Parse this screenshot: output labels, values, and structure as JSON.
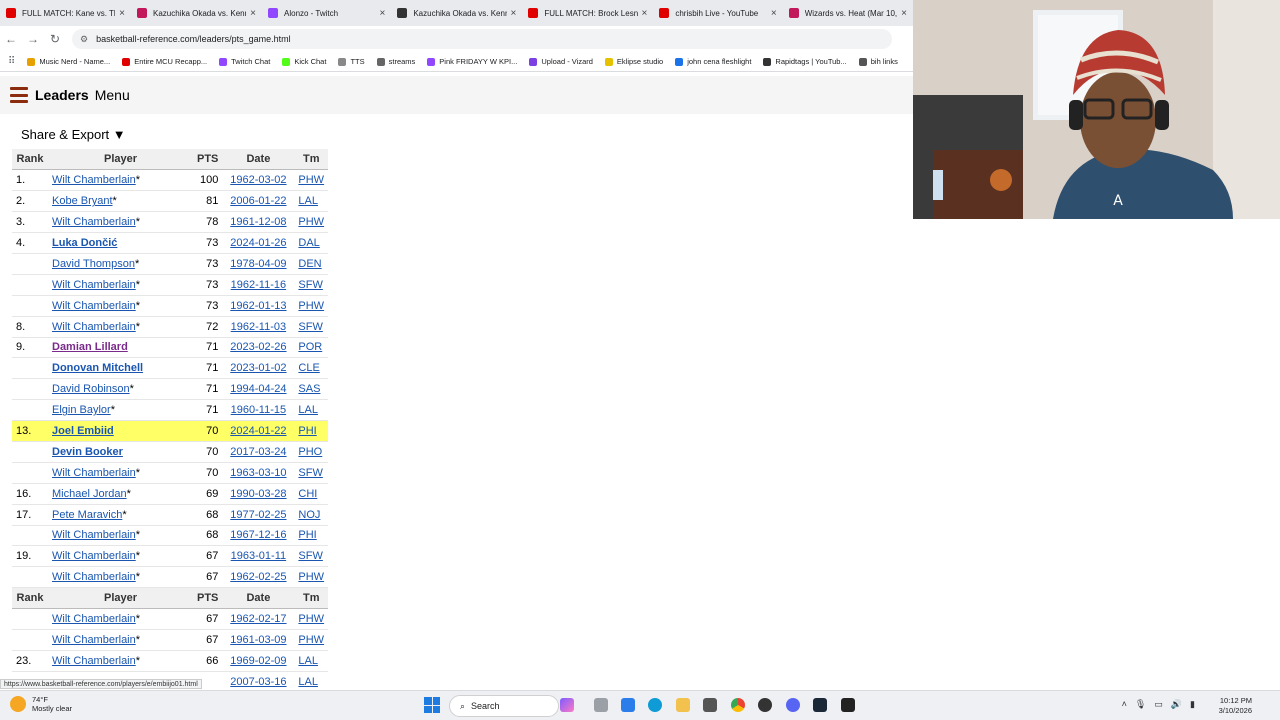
{
  "browser": {
    "tabs": [
      {
        "label": "FULL MATCH: Kane vs. The",
        "color": "#e00000"
      },
      {
        "label": "Kazuchika Okada vs. Kenn",
        "color": "#c2185b"
      },
      {
        "label": "Alonzo - Twitch",
        "color": "#9146ff"
      },
      {
        "label": "Kazuchika Okada vs. Kenn",
        "color": "#333333"
      },
      {
        "label": "FULL MATCH: Brock Lesna",
        "color": "#e00000"
      },
      {
        "label": "chrisbih Live - YouTube",
        "color": "#e00000"
      },
      {
        "label": "Wizards vs. Heat (Mar 10,",
        "color": "#c2185b"
      }
    ],
    "url": "basketball-reference.com/leaders/pts_game.html",
    "bookmarks": [
      {
        "label": "Music Nerd - Name...",
        "color": "#e6a100"
      },
      {
        "label": "Entire MCU Recapp...",
        "color": "#e00000"
      },
      {
        "label": "Twitch Chat",
        "color": "#9146ff"
      },
      {
        "label": "Kick Chat",
        "color": "#53fc18"
      },
      {
        "label": "TTS",
        "color": "#888888"
      },
      {
        "label": "streams",
        "color": "#666666"
      },
      {
        "label": "Pink FRIDAYY W KPI...",
        "color": "#9146ff"
      },
      {
        "label": "Upload - Vizard",
        "color": "#7b3fe4"
      },
      {
        "label": "Eklipse studio",
        "color": "#e6c100"
      },
      {
        "label": "john cena fleshlight",
        "color": "#1a73e8"
      },
      {
        "label": "Rapidtags | YouTub...",
        "color": "#333333"
      },
      {
        "label": "bih links",
        "color": "#555555"
      }
    ]
  },
  "site": {
    "title": "Leaders",
    "menu": "Menu",
    "share_export": "Share & Export ▼"
  },
  "table": {
    "headers": {
      "rank": "Rank",
      "player": "Player",
      "pts": "PTS",
      "date": "Date",
      "tm": "Tm"
    },
    "rows": [
      {
        "rank": "1.",
        "player": "Wilt Chamberlain",
        "star": "*",
        "pts": "100",
        "date": "1962-03-02",
        "tm": "PHW",
        "style": "normal"
      },
      {
        "rank": "2.",
        "player": "Kobe Bryant",
        "star": "*",
        "pts": "81",
        "date": "2006-01-22",
        "tm": "LAL",
        "style": "normal"
      },
      {
        "rank": "3.",
        "player": "Wilt Chamberlain",
        "star": "*",
        "pts": "78",
        "date": "1961-12-08",
        "tm": "PHW",
        "style": "normal"
      },
      {
        "rank": "4.",
        "player": "Luka Dončić",
        "star": "",
        "pts": "73",
        "date": "2024-01-26",
        "tm": "DAL",
        "style": "active"
      },
      {
        "rank": "",
        "player": "David Thompson",
        "star": "*",
        "pts": "73",
        "date": "1978-04-09",
        "tm": "DEN",
        "style": "normal"
      },
      {
        "rank": "",
        "player": "Wilt Chamberlain",
        "star": "*",
        "pts": "73",
        "date": "1962-11-16",
        "tm": "SFW",
        "style": "normal"
      },
      {
        "rank": "",
        "player": "Wilt Chamberlain",
        "star": "*",
        "pts": "73",
        "date": "1962-01-13",
        "tm": "PHW",
        "style": "normal"
      },
      {
        "rank": "8.",
        "player": "Wilt Chamberlain",
        "star": "*",
        "pts": "72",
        "date": "1962-11-03",
        "tm": "SFW",
        "style": "normal"
      },
      {
        "rank": "9.",
        "player": "Damian Lillard",
        "star": "",
        "pts": "71",
        "date": "2023-02-26",
        "tm": "POR",
        "style": "visited"
      },
      {
        "rank": "",
        "player": "Donovan Mitchell",
        "star": "",
        "pts": "71",
        "date": "2023-01-02",
        "tm": "CLE",
        "style": "active"
      },
      {
        "rank": "",
        "player": "David Robinson",
        "star": "*",
        "pts": "71",
        "date": "1994-04-24",
        "tm": "SAS",
        "style": "normal"
      },
      {
        "rank": "",
        "player": "Elgin Baylor",
        "star": "*",
        "pts": "71",
        "date": "1960-11-15",
        "tm": "LAL",
        "style": "normal"
      },
      {
        "rank": "13.",
        "player": "Joel Embiid",
        "star": "",
        "pts": "70",
        "date": "2024-01-22",
        "tm": "PHI",
        "style": "active",
        "highlight": true
      },
      {
        "rank": "",
        "player": "Devin Booker",
        "star": "",
        "pts": "70",
        "date": "2017-03-24",
        "tm": "PHO",
        "style": "active"
      },
      {
        "rank": "",
        "player": "Wilt Chamberlain",
        "star": "*",
        "pts": "70",
        "date": "1963-03-10",
        "tm": "SFW",
        "style": "normal"
      },
      {
        "rank": "16.",
        "player": "Michael Jordan",
        "star": "*",
        "pts": "69",
        "date": "1990-03-28",
        "tm": "CHI",
        "style": "normal"
      },
      {
        "rank": "17.",
        "player": "Pete Maravich",
        "star": "*",
        "pts": "68",
        "date": "1977-02-25",
        "tm": "NOJ",
        "style": "normal"
      },
      {
        "rank": "",
        "player": "Wilt Chamberlain",
        "star": "*",
        "pts": "68",
        "date": "1967-12-16",
        "tm": "PHI",
        "style": "normal"
      },
      {
        "rank": "19.",
        "player": "Wilt Chamberlain",
        "star": "*",
        "pts": "67",
        "date": "1963-01-11",
        "tm": "SFW",
        "style": "normal"
      },
      {
        "rank": "",
        "player": "Wilt Chamberlain",
        "star": "*",
        "pts": "67",
        "date": "1962-02-25",
        "tm": "PHW",
        "style": "normal"
      }
    ],
    "rows2": [
      {
        "rank": "",
        "player": "Wilt Chamberlain",
        "star": "*",
        "pts": "67",
        "date": "1962-02-17",
        "tm": "PHW",
        "style": "normal"
      },
      {
        "rank": "",
        "player": "Wilt Chamberlain",
        "star": "*",
        "pts": "67",
        "date": "1961-03-09",
        "tm": "PHW",
        "style": "normal"
      },
      {
        "rank": "23.",
        "player": "Wilt Chamberlain",
        "star": "*",
        "pts": "66",
        "date": "1969-02-09",
        "tm": "LAL",
        "style": "normal"
      },
      {
        "rank": "",
        "player": "",
        "star": "",
        "pts": "",
        "date": "2007-03-16",
        "tm": "LAL",
        "style": "normal"
      }
    ]
  },
  "status_url": "https://www.basketball-reference.com/players/e/embiijo01.html",
  "taskbar": {
    "weather_temp": "74°F",
    "weather_desc": "Mostly clear",
    "search": "Search",
    "time": "10:12 PM",
    "date": "3/10/2026"
  }
}
